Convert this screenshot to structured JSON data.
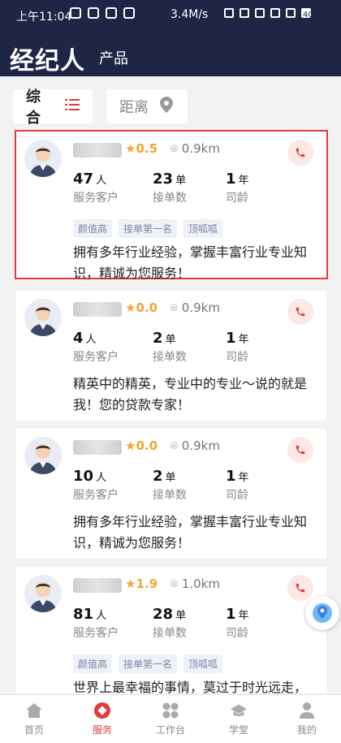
{
  "status_bar": {
    "time": "上午11:04",
    "network_speed": "3.4M/s",
    "battery": "40"
  },
  "header": {
    "title": "经纪人",
    "subtitle": "产品"
  },
  "filters": [
    {
      "label": "综合",
      "icon": "list-icon",
      "active": true
    },
    {
      "label": "距离",
      "icon": "location-pin-icon",
      "active": false
    }
  ],
  "agents": [
    {
      "rating": "0.5",
      "distance": "0.9km",
      "stats": [
        {
          "value": "47",
          "unit": "人",
          "label": "服务客户"
        },
        {
          "value": "23",
          "unit": "单",
          "label": "接单数"
        },
        {
          "value": "1",
          "unit": "年",
          "label": "司龄"
        }
      ],
      "tags": [
        "颜值高",
        "接单第一名",
        "顶呱呱"
      ],
      "description": "拥有多年行业经验，掌握丰富行业专业知识，精诚为您服务！",
      "selected": true
    },
    {
      "rating": "0.0",
      "distance": "0.9km",
      "stats": [
        {
          "value": "4",
          "unit": "人",
          "label": "服务客户"
        },
        {
          "value": "2",
          "unit": "单",
          "label": "接单数"
        },
        {
          "value": "1",
          "unit": "年",
          "label": "司龄"
        }
      ],
      "tags": [],
      "description": "精英中的精英，专业中的专业～说的就是我！您的贷款专家！",
      "selected": false
    },
    {
      "rating": "0.0",
      "distance": "0.9km",
      "stats": [
        {
          "value": "10",
          "unit": "人",
          "label": "服务客户"
        },
        {
          "value": "2",
          "unit": "单",
          "label": "接单数"
        },
        {
          "value": "1",
          "unit": "年",
          "label": "司龄"
        }
      ],
      "tags": [],
      "description": "拥有多年行业经验，掌握丰富行业专业知识，精诚为您服务！",
      "selected": false
    },
    {
      "rating": "1.9",
      "distance": "1.0km",
      "stats": [
        {
          "value": "81",
          "unit": "人",
          "label": "服务客户"
        },
        {
          "value": "28",
          "unit": "单",
          "label": "接单数"
        },
        {
          "value": "1",
          "unit": "年",
          "label": "司龄"
        }
      ],
      "tags": [
        "颜值高",
        "接单第一名",
        "顶呱呱"
      ],
      "description": "世界上最幸福的事情，莫过于时光远走，",
      "selected": false
    }
  ],
  "bottom_nav": [
    {
      "label": "首页",
      "icon": "home-icon",
      "active": false
    },
    {
      "label": "服务",
      "icon": "service-icon",
      "active": true
    },
    {
      "label": "工作台",
      "icon": "workbench-icon",
      "active": false
    },
    {
      "label": "学堂",
      "icon": "graduation-cap-icon",
      "active": false
    },
    {
      "label": "我的",
      "icon": "profile-icon",
      "active": false
    }
  ],
  "colors": {
    "header_bg": "#1f2544",
    "accent": "#e23b3b",
    "rating": "#f3a530"
  }
}
